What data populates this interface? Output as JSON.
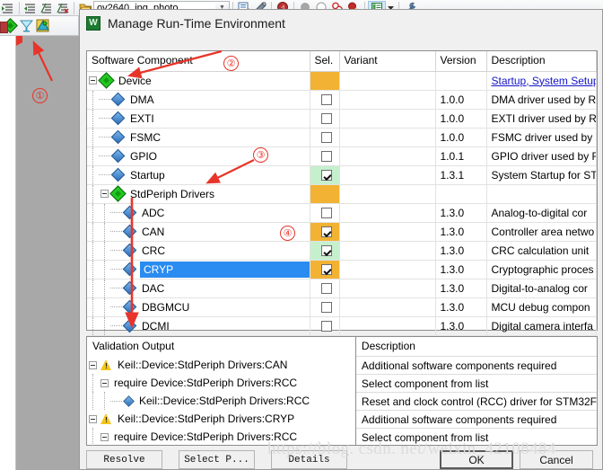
{
  "ide": {
    "toolbar_icons": [
      "indent-decrease-icon",
      "indent-increase-icon",
      "comment-icon",
      "uncomment-icon"
    ],
    "project_combo": {
      "value": "ov2640_jpg_photo",
      "arrow": "chevron-down-icon"
    },
    "toolbar_icons_right": [
      "target-options-icon",
      "magic-wand-icon",
      "debug-icon",
      "bookmark-filled-icon",
      "bookmark-empty-icon",
      "breakpoints-icon",
      "kill-breakpoints-icon",
      "manage-project-items-icon",
      "configure-icon"
    ],
    "toolbar2_icons": [
      "manage-rte-icon",
      "pack-installer-icon",
      "pack-filter-icon"
    ]
  },
  "dialog": {
    "icon": "rte-green-icon",
    "title": "Manage Run-Time Environment"
  },
  "table": {
    "headers": {
      "name": "Software Component",
      "sel": "Sel.",
      "variant": "Variant",
      "version": "Version",
      "description": "Description"
    },
    "rows": [
      {
        "label": "Device",
        "icon": "diamond-green-icon",
        "level": 0,
        "expander": true,
        "sel": "none",
        "cell_bg": "orange",
        "variant": "",
        "version": "",
        "description": "Startup, System Setup",
        "desc_link": true
      },
      {
        "label": "DMA",
        "icon": "diamond-blue-icon",
        "level": 1,
        "expander": false,
        "sel": "off",
        "cell_bg": "white",
        "variant": "",
        "version": "1.0.0",
        "description": "DMA driver used by R",
        "desc_link": false
      },
      {
        "label": "EXTI",
        "icon": "diamond-blue-icon",
        "level": 1,
        "expander": false,
        "sel": "off",
        "cell_bg": "white",
        "variant": "",
        "version": "1.0.0",
        "description": "EXTI driver used by RT",
        "desc_link": false
      },
      {
        "label": "FSMC",
        "icon": "diamond-blue-icon",
        "level": 1,
        "expander": false,
        "sel": "off",
        "cell_bg": "white",
        "variant": "",
        "version": "1.0.0",
        "description": "FSMC driver used by",
        "desc_link": false
      },
      {
        "label": "GPIO",
        "icon": "diamond-blue-icon",
        "level": 1,
        "expander": false,
        "sel": "off",
        "cell_bg": "white",
        "variant": "",
        "version": "1.0.1",
        "description": "GPIO driver used by R",
        "desc_link": false
      },
      {
        "label": "Startup",
        "icon": "diamond-blue-icon",
        "level": 1,
        "expander": false,
        "sel": "on",
        "cell_bg": "green",
        "variant": "",
        "version": "1.3.1",
        "description": "System Startup for ST",
        "desc_link": false
      },
      {
        "label": "StdPeriph Drivers",
        "icon": "diamond-green-icon",
        "level": 1,
        "expander": true,
        "sel": "none",
        "cell_bg": "orange",
        "variant": "",
        "version": "",
        "description": "",
        "desc_link": false
      },
      {
        "label": "ADC",
        "icon": "diamond-blue-icon",
        "level": 2,
        "expander": false,
        "sel": "off",
        "cell_bg": "white",
        "variant": "",
        "version": "1.3.0",
        "description": "Analog-to-digital cor",
        "desc_link": false
      },
      {
        "label": "CAN",
        "icon": "diamond-blue-icon",
        "level": 2,
        "expander": false,
        "sel": "on",
        "cell_bg": "orange",
        "variant": "",
        "version": "1.3.0",
        "description": "Controller area netwo",
        "desc_link": false
      },
      {
        "label": "CRC",
        "icon": "diamond-blue-icon",
        "level": 2,
        "expander": false,
        "sel": "on",
        "cell_bg": "green",
        "variant": "",
        "version": "1.3.0",
        "description": "CRC calculation unit",
        "desc_link": false
      },
      {
        "label": "CRYP",
        "icon": "diamond-blue-icon",
        "level": 2,
        "expander": false,
        "sel": "on",
        "cell_bg": "orange",
        "variant": "",
        "version": "1.3.0",
        "description": "Cryptographic proces",
        "desc_link": false,
        "selected": true
      },
      {
        "label": "DAC",
        "icon": "diamond-blue-icon",
        "level": 2,
        "expander": false,
        "sel": "off",
        "cell_bg": "white",
        "variant": "",
        "version": "1.3.0",
        "description": "Digital-to-analog cor",
        "desc_link": false
      },
      {
        "label": "DBGMCU",
        "icon": "diamond-blue-icon",
        "level": 2,
        "expander": false,
        "sel": "off",
        "cell_bg": "white",
        "variant": "",
        "version": "1.3.0",
        "description": "MCU debug compon",
        "desc_link": false
      },
      {
        "label": "DCMI",
        "icon": "diamond-blue-icon",
        "level": 2,
        "expander": false,
        "sel": "off",
        "cell_bg": "white",
        "variant": "",
        "version": "1.3.0",
        "description": "Digital camera interfa",
        "desc_link": false
      }
    ]
  },
  "validation": {
    "title": "Validation Output",
    "desc_header": "Description",
    "rows": [
      {
        "text": "Keil::Device:StdPeriph Drivers:CAN",
        "indent": 0,
        "icon": "warning-icon",
        "expander": true,
        "description": "Additional software components required"
      },
      {
        "text": "require Device:StdPeriph Drivers:RCC",
        "indent": 1,
        "icon": "none",
        "expander": true,
        "description": "Select component from list"
      },
      {
        "text": "Keil::Device:StdPeriph Drivers:RCC",
        "indent": 2,
        "icon": "diamond-blue-icon",
        "expander": false,
        "description": "Reset and clock control (RCC) driver for STM32F"
      },
      {
        "text": "Keil::Device:StdPeriph Drivers:CRYP",
        "indent": 0,
        "icon": "warning-icon",
        "expander": true,
        "description": "Additional software components required"
      },
      {
        "text": "require Device:StdPeriph Drivers:RCC",
        "indent": 1,
        "icon": "none",
        "expander": true,
        "description": "Select component from list"
      }
    ]
  },
  "buttons": {
    "resolve": "Resolve",
    "select_packs": "Select P...",
    "details": "Details",
    "ok": "OK",
    "cancel": "Cancel"
  },
  "annotations": {
    "marker1": "①",
    "marker2": "②",
    "marker3": "③",
    "marker4": "④"
  },
  "watermark": "https://blog. csdn. net/weixin_42108484",
  "colors": {
    "orange": "#f2b233",
    "green": "#c6efce",
    "selection_blue": "#2a8bf0",
    "annotation_red": "#e8342a",
    "link_blue": "#1414c8"
  }
}
